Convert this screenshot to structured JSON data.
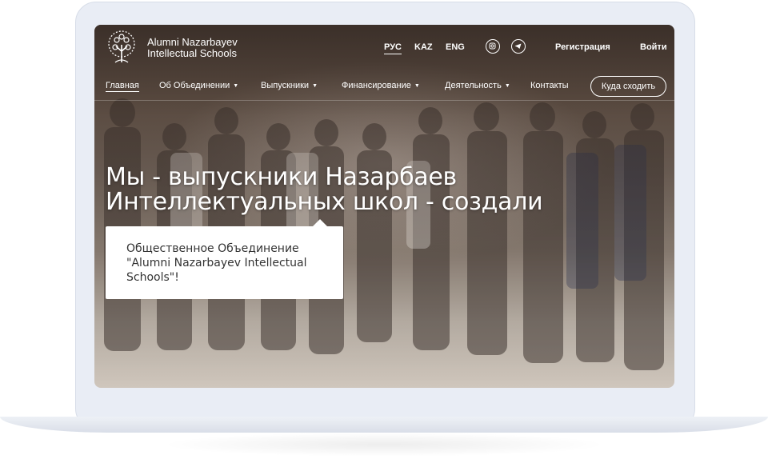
{
  "logo": {
    "line1": "Alumni Nazarbayev",
    "line2": "Intellectual Schools"
  },
  "languages": [
    "РУС",
    "KAZ",
    "ENG"
  ],
  "header_links": {
    "register": "Регистрация",
    "login": "Войти"
  },
  "nav": {
    "items": [
      {
        "label": "Главная"
      },
      {
        "label": "Об Объединении"
      },
      {
        "label": "Выпускники"
      },
      {
        "label": "Финансирование"
      },
      {
        "label": "Деятельность"
      },
      {
        "label": "Контакты"
      }
    ],
    "dropdown_caret": "▼",
    "cta": "Куда сходить"
  },
  "hero": {
    "title_line1": "Мы - выпускники Назарбаев",
    "title_line2": "Интеллектуальных школ - создали",
    "card_line1": "Общественное Объединение",
    "card_line2": "\"Alumni Nazarbayev Intellectual",
    "card_line3": "Schools\"!"
  },
  "icons": [
    "tree-logo-icon",
    "instagram-icon",
    "telegram-icon",
    "dropdown-caret-icon"
  ]
}
